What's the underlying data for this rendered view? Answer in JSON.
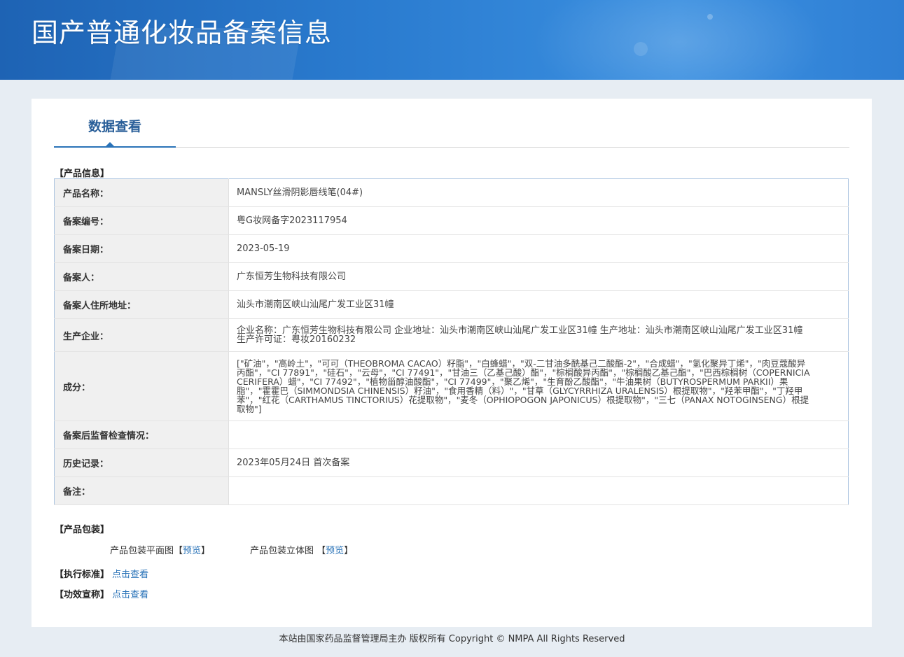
{
  "header": {
    "title": "国产普通化妆品备案信息"
  },
  "tab": {
    "label": "数据查看"
  },
  "sections": {
    "product_info": "【产品信息】",
    "product_package": "【产品包装】",
    "standard": "【执行标准】",
    "efficacy": "【功效宣称】"
  },
  "table": {
    "rows": [
      {
        "label": "产品名称：",
        "value": "MANSLY丝滑阴影唇线笔(04#)"
      },
      {
        "label": "备案编号：",
        "value": "粤G妆网备字2023117954"
      },
      {
        "label": "备案日期：",
        "value": "2023-05-19"
      },
      {
        "label": "备案人：",
        "value": "广东恒芳生物科技有限公司"
      },
      {
        "label": "备案人住所地址：",
        "value": "汕头市潮南区峡山汕尾广发工业区31幢"
      },
      {
        "label": "生产企业：",
        "value": "企业名称：广东恒芳生物科技有限公司 企业地址：汕头市潮南区峡山汕尾广发工业区31幢 生产地址：汕头市潮南区峡山汕尾广发工业区31幢 生产许可证：粤妆20160232"
      },
      {
        "label": "成分：",
        "value": "[\"矿油\"，\"高岭土\"，\"可可（THEOBROMA CACAO）籽脂\"，\"白蜂蜡\"，\"双-二甘油多酰基己二酸酯-2\"，\"合成蜡\"，\"氢化聚异丁烯\"，\"肉豆蔻酸异丙酯\"，\"CI 77891\"，\"硅石\"，\"云母\"，\"CI 77491\"，\"甘油三（乙基己酸）酯\"，\"棕榈酸异丙酯\"，\"棕榈酸乙基己酯\"，\"巴西棕榈树（COPERNICIA CERIFERA）蜡\"，\"CI 77492\"，\"植物甾醇油酸酯\"，\"CI 77499\"，\"聚乙烯\"，\"生育酚乙酸酯\"，\"牛油果树（BUTYROSPERMUM PARKII）果脂\"，\"霍霍巴（SIMMONDSIA CHINENSIS）籽油\"，\"食用香精（料）\"，\"甘草（GLYCYRRHIZA URALENSIS）根提取物\"，\"羟苯甲酯\"，\"丁羟甲苯\"，\"红花（CARTHAMUS TINCTORIUS）花提取物\"，\"麦冬（OPHIOPOGON JAPONICUS）根提取物\"，\"三七（PANAX NOTOGINSENG）根提取物\"]"
      },
      {
        "label": "备案后监督检查情况：",
        "value": ""
      },
      {
        "label": "历史记录：",
        "value": "2023年05月24日 首次备案"
      },
      {
        "label": "备注：",
        "value": ""
      }
    ]
  },
  "package": {
    "flat_label": "产品包装平面图",
    "solid_label": "产品包装立体图",
    "bracket_open": "【",
    "bracket_close": "】",
    "preview": "预览"
  },
  "links": {
    "view": "点击查看"
  },
  "footer": {
    "text": "本站由国家药品监督管理局主办 版权所有 Copyright © NMPA All Rights Reserved"
  }
}
